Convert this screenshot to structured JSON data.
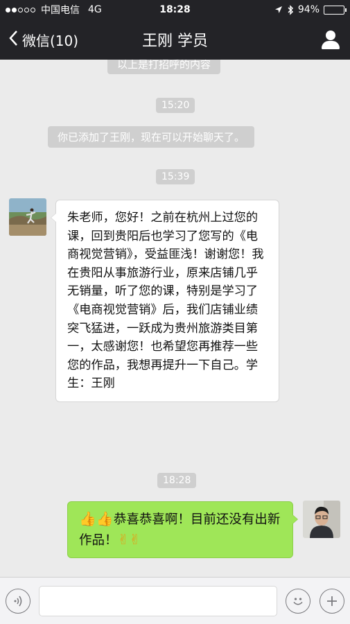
{
  "status_bar": {
    "carrier": "中国电信",
    "network": "4G",
    "time": "18:28",
    "battery": "94%",
    "battery_level": 0.94
  },
  "nav": {
    "back_label": "微信(10)",
    "title": "王刚 学员"
  },
  "chat": {
    "top_partial": "以上是打招呼的内容",
    "time_1": "15:20",
    "system_msg": "你已添加了王刚，现在可以开始聊天了。",
    "time_2": "15:39",
    "message_in": "朱老师，您好！之前在杭州上过您的课，回到贵阳后也学习了您写的《电商视觉营销》，受益匪浅！谢谢您！我在贵阳从事旅游行业，原来店铺几乎无销量，听了您的课，特别是学习了《电商视觉营销》后，我们店铺业绩突飞猛进，一跃成为贵州旅游类目第一，太感谢您！也希望您再推荐一些您的作品，我想再提升一下自己。学生：王刚",
    "time_3": "18:28",
    "message_out_prefix": "👍👍",
    "message_out": "恭喜恭喜啊！目前还没有出新作品！",
    "message_out_suffix": "✌✌"
  },
  "colors": {
    "nav_bg": "#232327",
    "chat_bg": "#ebebeb",
    "bubble_out": "#9fe658",
    "bubble_in": "#ffffff"
  }
}
